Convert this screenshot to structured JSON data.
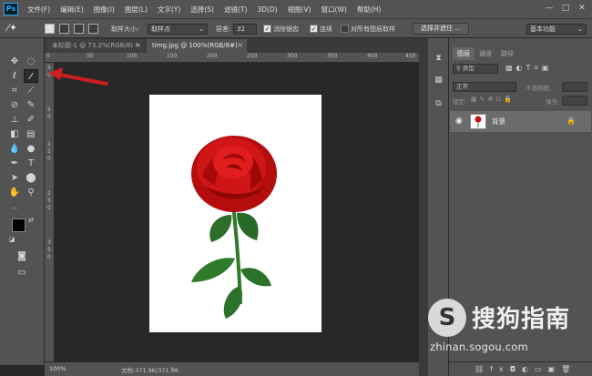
{
  "app": {
    "logo": "Ps",
    "menus": [
      "文件(F)",
      "编辑(E)",
      "图像(I)",
      "图层(L)",
      "文字(Y)",
      "选择(S)",
      "滤镜(T)",
      "3D(D)",
      "视图(V)",
      "窗口(W)",
      "帮助(H)"
    ],
    "window_controls": {
      "minimize": "—",
      "maximize": "□",
      "close": "✕"
    }
  },
  "options_bar": {
    "tool_icon": "magic-wand-icon",
    "sample_size_label": "取样大小:",
    "sample_size_value": "取样点",
    "tolerance_label": "容差:",
    "tolerance_value": "32",
    "antialias_label": "消除锯齿",
    "antialias_checked": true,
    "contiguous_label": "连续",
    "contiguous_checked": true,
    "sample_all_label": "对所有图层取样",
    "sample_all_checked": false,
    "select_mask_button": "选择并遮住 ...",
    "workspace": "基本功能"
  },
  "documents": {
    "tabs": [
      {
        "title": "未标题-1 @ 73.2%(RGB/8) *",
        "active": false
      },
      {
        "title": "timg.jpg @ 100%(RGB/8#)",
        "active": true
      }
    ]
  },
  "ruler": {
    "h_ticks": [
      "0",
      "50",
      "100",
      "150",
      "200",
      "250",
      "300",
      "350",
      "400",
      "450"
    ],
    "v_ticks": [
      "5",
      "0",
      "5",
      "0",
      "1",
      "5",
      "0",
      "2",
      "5",
      "0",
      "3",
      "5",
      "0"
    ]
  },
  "status": {
    "zoom": "100%",
    "doc_info": "文档:371.9K/371.9K",
    "arrow": "›"
  },
  "color_swatches": {
    "foreground": "#000000",
    "background": "#ffffff"
  },
  "layers_panel": {
    "tabs": [
      "图层",
      "通道",
      "路径"
    ],
    "kind_filter": "类型",
    "blend_mode": "正常",
    "opacity_label": "不透明度:",
    "lock_label": "锁定:",
    "fill_label": "填充:",
    "layers": [
      {
        "name": "背景",
        "visible": true,
        "locked": true
      }
    ]
  },
  "watermark": {
    "title": "搜狗指南",
    "url": "zhinan.sogou.com"
  },
  "colors": {
    "chrome": "#535353",
    "canvas_bg": "#282828",
    "accent_logo": "#31a8ff",
    "annotation_arrow": "#cc1f1f"
  }
}
